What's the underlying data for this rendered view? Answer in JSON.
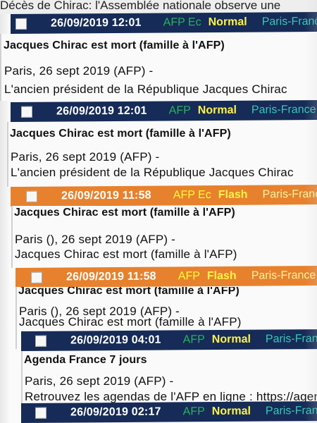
{
  "top_banner": "Décès de Chirac: l'Assemblée nationale observe une",
  "dispatches": [
    {
      "datetime": "26/09/2019 12:01",
      "source": "AFP Ec",
      "priority": "Normal",
      "location": "Paris-France",
      "title": "Jacques Chirac est mort (famille à l'AFP)",
      "dateline": "Paris, 26 sept 2019 (AFP) -",
      "summary": "L'ancien président de la République Jacques Chirac"
    },
    {
      "datetime": "26/09/2019 12:01",
      "source": "AFP",
      "priority": "Normal",
      "location": "Paris-France",
      "title": "Jacques Chirac est mort (famille à l'AFP)",
      "dateline": "Paris, 26 sept 2019 (AFP) -",
      "summary": "L'ancien président de la République Jacques Chirac"
    },
    {
      "datetime": "26/09/2019 11:58",
      "source": "AFP Ec",
      "priority": "Flash",
      "location": "Paris-France",
      "title": "Jacques Chirac est mort (famille à l'AFP)",
      "dateline": "Paris (), 26 sept 2019 (AFP) -",
      "summary": "Jacques Chirac est mort (famille à l'AFP)"
    },
    {
      "datetime": "26/09/2019 11:58",
      "source": "AFP",
      "priority": "Flash",
      "location": "Paris-France",
      "title": "Jacques Chirac est mort (famille à l'AFP)",
      "dateline": "Paris (), 26 sept 2019 (AFP) -",
      "summary": "Jacques Chirac est mort (famille à l'AFP)"
    },
    {
      "datetime": "26/09/2019 04:01",
      "source": "AFP",
      "priority": "Normal",
      "location": "Paris-France",
      "title": "Agenda France 7 jours",
      "dateline": "Paris, 26 sept 2019 (AFP) -",
      "summary": "Retrouvez les agendas de l'AFP en ligne : https://agen"
    },
    {
      "datetime": "26/09/2019 02:17",
      "source": "AFP",
      "priority": "Normal",
      "location": "Paris-France"
    }
  ]
}
